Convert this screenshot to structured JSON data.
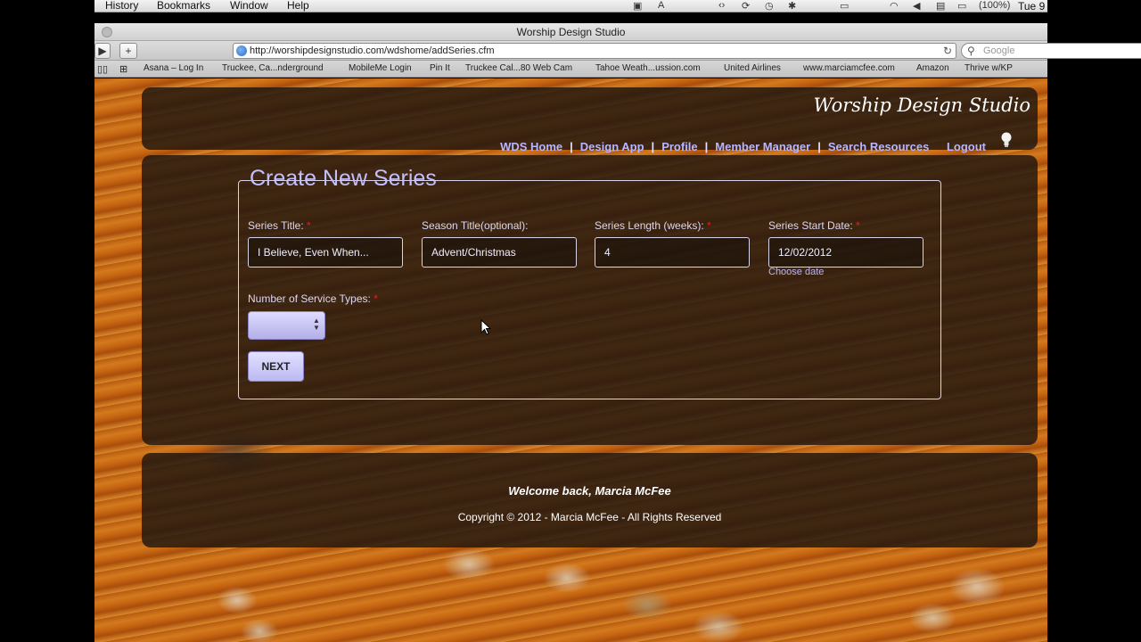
{
  "menubar": {
    "items": [
      "History",
      "Bookmarks",
      "Window",
      "Help"
    ],
    "status_battery": "(100%)",
    "status_clock": "Tue 9"
  },
  "window": {
    "title": "Worship Design Studio"
  },
  "toolbar": {
    "url": "http://worshipdesignstudio.com/wdshome/addSeries.cfm",
    "search_placeholder": "Google"
  },
  "bookmarks": [
    "Asana – Log In",
    "Truckee, Ca...nderground",
    "MobileMe Login",
    "Pin It",
    "Truckee Cal...80 Web Cam",
    "Tahoe Weath...ussion.com",
    "United Airlines",
    "www.marciamcfee.com",
    "Amazon",
    "Thrive w/KP"
  ],
  "site": {
    "title": "Worship Design Studio",
    "nav": [
      "WDS Home",
      "Design App",
      "Profile",
      "Member Manager",
      "Search Resources",
      "Logout"
    ]
  },
  "form": {
    "legend": "Create New Series",
    "fields": [
      {
        "label": "Series Title:",
        "value": "I Believe, Even When...",
        "required": true
      },
      {
        "label": "Season Title(optional):",
        "value": "Advent/Christmas",
        "required": false
      },
      {
        "label": "Series Length (weeks):",
        "value": "4",
        "required": true
      },
      {
        "label": "Series Start Date:",
        "value": "12/02/2012",
        "required": true
      }
    ],
    "choose_date_link": "Choose date",
    "service_types_label": "Number of Service Types:",
    "service_types_value": "",
    "next_button": "NEXT"
  },
  "footer": {
    "welcome": "Welcome back, Marcia McFee",
    "copyright": "Copyright © 2012 - Marcia McFee - All Rights Reserved"
  },
  "colors": {
    "accent_link": "#b9b6ff",
    "legend": "#c3bfff",
    "required_star": "#dd2222",
    "panel_bg": "#1e1610"
  }
}
